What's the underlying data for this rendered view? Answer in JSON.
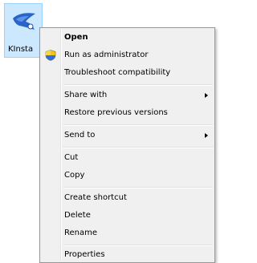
{
  "desktop": {
    "file": {
      "label": "KInsta",
      "icon": "kinsta-app-icon"
    }
  },
  "context_menu": {
    "items": [
      {
        "label": "Open",
        "bold": true
      },
      {
        "label": "Run as administrator",
        "icon": "uac-shield-icon"
      },
      {
        "label": "Troubleshoot compatibility"
      },
      {
        "label": "Share with",
        "submenu": true
      },
      {
        "label": "Restore previous versions"
      },
      {
        "label": "Send to",
        "submenu": true
      },
      {
        "label": "Cut"
      },
      {
        "label": "Copy"
      },
      {
        "label": "Create shortcut"
      },
      {
        "label": "Delete"
      },
      {
        "label": "Rename"
      },
      {
        "label": "Properties"
      }
    ]
  },
  "colors": {
    "selection_bg": "#cce8ff",
    "menu_bg": "#f0f0f0",
    "icon_blue": "#2a64c8"
  }
}
